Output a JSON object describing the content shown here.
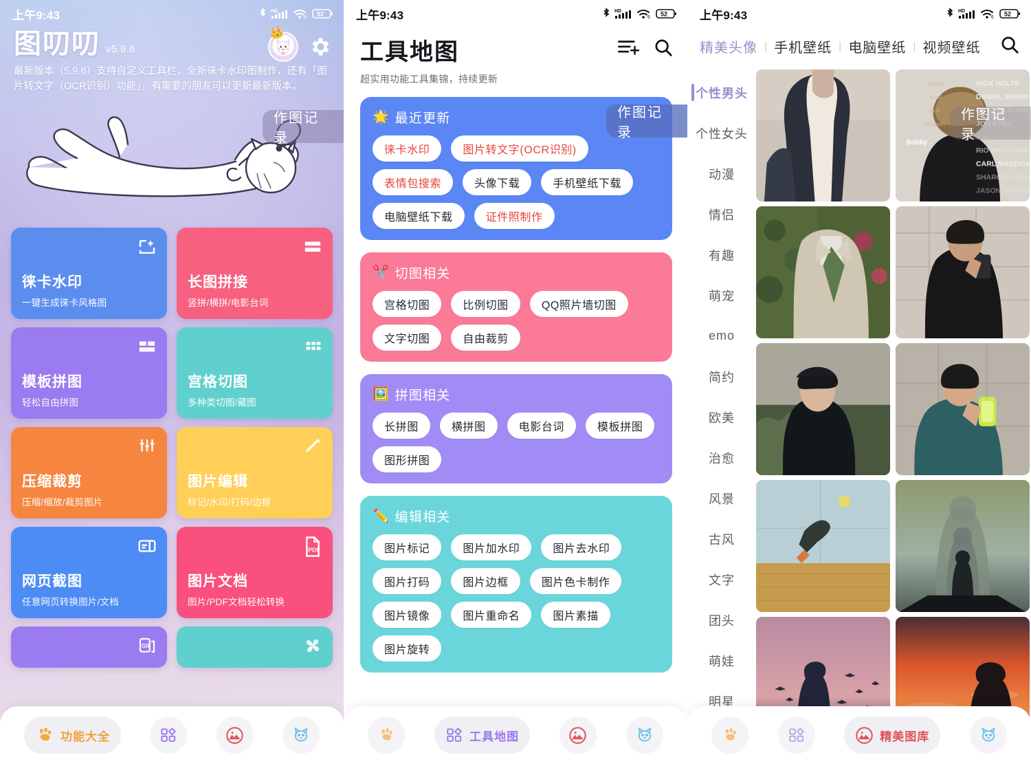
{
  "status_bar": {
    "time": "上午9:43",
    "icons": [
      "bluetooth-icon",
      "hd-icon",
      "signal-icon",
      "wifi6-icon",
      "battery-icon"
    ],
    "battery_level": "52"
  },
  "panel_home": {
    "app_title": "图叨叨",
    "version": "v5.9.6",
    "description": "最新版本（5.9.6）支持自定义工具栏，全新徕卡水印图制作，还有「图片转文字（OCR识别）功能」，有需要的朋友可以更新最新版本。",
    "avatar_icon": "cat-avatar-icon",
    "crown_icon": "crown-icon",
    "settings_icon": "gear-icon",
    "floating_button": "作图记录",
    "illustration": "lying-cat-illustration",
    "tiles": [
      {
        "name": "徕卡水印",
        "sub": "一键生成徕卡风格图",
        "color": "#5b8def",
        "icon": "magic-photo-icon"
      },
      {
        "name": "长图拼接",
        "sub": "竖拼/横拼/电影台词",
        "color": "#f8607f",
        "icon": "stack-rows-icon"
      },
      {
        "name": "模板拼图",
        "sub": "轻松自由拼图",
        "color": "#9b7bf0",
        "icon": "layout-template-icon"
      },
      {
        "name": "宫格切图",
        "sub": "多种类切图/藏图",
        "color": "#5fd0cd",
        "icon": "grid-nine-icon"
      },
      {
        "name": "压缩裁剪",
        "sub": "压缩/缩放/裁剪图片",
        "color": "#f5853f",
        "icon": "sliders-icon"
      },
      {
        "name": "图片编辑",
        "sub": "标记/水印/打码/边框",
        "color": "#ffcf57",
        "icon": "pencil-icon"
      },
      {
        "name": "网页截图",
        "sub": "任意网页转换图片/文档",
        "color": "#4d8cf5",
        "icon": "browser-capture-icon"
      },
      {
        "name": "图片文档",
        "sub": "图片/PDF文档轻松转换",
        "color": "#f9507e",
        "icon": "pdf-file-icon"
      },
      {
        "name": "",
        "sub": "",
        "color": "#9b7bf0",
        "icon": "gif-icon"
      },
      {
        "name": "",
        "sub": "",
        "color": "#5fd0cd",
        "icon": "pinwheel-icon"
      }
    ],
    "bottom_nav": [
      {
        "label": "功能大全",
        "icon": "paw-icon",
        "active": true
      },
      {
        "label": "",
        "icon": "shapes-icon",
        "active": false
      },
      {
        "label": "",
        "icon": "mountain-circle-icon",
        "active": false
      },
      {
        "label": "",
        "icon": "cat-face-icon",
        "active": false
      }
    ]
  },
  "panel_tools": {
    "title": "工具地图",
    "subtitle": "超实用功能工具集锦，持续更新",
    "actions": [
      "add-to-list-icon",
      "search-icon"
    ],
    "floating_button": "作图记录",
    "groups": [
      {
        "name": "最近更新",
        "emoji": "🌟",
        "icon": "sun-badge-icon",
        "color": "#5b87f5",
        "chips": [
          {
            "label": "徕卡水印",
            "hot": true
          },
          {
            "label": "图片转文字(OCR识别)",
            "hot": true
          },
          {
            "label": "表情包搜索",
            "hot": true
          },
          {
            "label": "头像下载",
            "hot": false
          },
          {
            "label": "手机壁纸下载",
            "hot": false
          },
          {
            "label": "电脑壁纸下载",
            "hot": false
          },
          {
            "label": "证件照制作",
            "hot": true
          }
        ]
      },
      {
        "name": "切图相关",
        "emoji": "✂️",
        "icon": "scissors-icon",
        "color": "#fa7a97",
        "chips": [
          {
            "label": "宫格切图",
            "hot": false
          },
          {
            "label": "比例切图",
            "hot": false
          },
          {
            "label": "QQ照片墙切图",
            "hot": false
          },
          {
            "label": "文字切图",
            "hot": false
          },
          {
            "label": "自由裁剪",
            "hot": false
          }
        ]
      },
      {
        "name": "拼图相关",
        "emoji": "🖼️",
        "icon": "board-icon",
        "color": "#a18cf5",
        "chips": [
          {
            "label": "长拼图",
            "hot": false
          },
          {
            "label": "横拼图",
            "hot": false
          },
          {
            "label": "电影台词",
            "hot": false
          },
          {
            "label": "模板拼图",
            "hot": false
          },
          {
            "label": "图形拼图",
            "hot": false
          }
        ]
      },
      {
        "name": "编辑相关",
        "emoji": "✏️",
        "icon": "pencil-icon",
        "color": "#6ad6dc",
        "chips": [
          {
            "label": "图片标记",
            "hot": false
          },
          {
            "label": "图片加水印",
            "hot": false
          },
          {
            "label": "图片去水印",
            "hot": false
          },
          {
            "label": "图片打码",
            "hot": false
          },
          {
            "label": "图片边框",
            "hot": false
          },
          {
            "label": "图片色卡制作",
            "hot": false
          },
          {
            "label": "图片镜像",
            "hot": false
          },
          {
            "label": "图片重命名",
            "hot": false
          },
          {
            "label": "图片素描",
            "hot": false
          },
          {
            "label": "图片旋转",
            "hot": false
          }
        ]
      }
    ],
    "bottom_nav": [
      {
        "label": "",
        "icon": "paw-icon",
        "active": false
      },
      {
        "label": "工具地图",
        "icon": "shapes-icon",
        "active": true
      },
      {
        "label": "",
        "icon": "mountain-circle-icon",
        "active": false
      },
      {
        "label": "",
        "icon": "cat-face-icon",
        "active": false
      }
    ]
  },
  "panel_gallery": {
    "tabs": [
      {
        "label": "精美头像",
        "active": true
      },
      {
        "label": "手机壁纸",
        "active": false
      },
      {
        "label": "电脑壁纸",
        "active": false
      },
      {
        "label": "视频壁纸",
        "active": false
      }
    ],
    "search_icon": "search-icon",
    "floating_button": "作图记录",
    "categories": [
      {
        "label": "个性男头",
        "active": true
      },
      {
        "label": "个性女头",
        "active": false
      },
      {
        "label": "动漫",
        "active": false
      },
      {
        "label": "情侣",
        "active": false
      },
      {
        "label": "有趣",
        "active": false
      },
      {
        "label": "萌宠",
        "active": false
      },
      {
        "label": "emo",
        "active": false
      },
      {
        "label": "简约",
        "active": false
      },
      {
        "label": "欧美",
        "active": false
      },
      {
        "label": "治愈",
        "active": false
      },
      {
        "label": "风景",
        "active": false
      },
      {
        "label": "古风",
        "active": false
      },
      {
        "label": "文字",
        "active": false
      },
      {
        "label": "团头",
        "active": false
      },
      {
        "label": "萌娃",
        "active": false
      },
      {
        "label": "明星",
        "active": false
      }
    ],
    "photos": [
      {
        "name": "man-white-tank-top",
        "kind": "portrait-tank"
      },
      {
        "name": "man-back-credits-text",
        "kind": "credits"
      },
      {
        "name": "man-suit-green-tie-garden",
        "kind": "suit-garden"
      },
      {
        "name": "man-black-suit-mirror-selfie",
        "kind": "mirror-dark"
      },
      {
        "name": "man-beret-black-coat-outdoors",
        "kind": "beret"
      },
      {
        "name": "man-teal-sweater-phone-selfie",
        "kind": "teal-selfie"
      },
      {
        "name": "floating-person-field-moon",
        "kind": "field-moon"
      },
      {
        "name": "layered-silhouettes-fog",
        "kind": "fog-silhouette"
      },
      {
        "name": "silhouette-birds-dusk",
        "kind": "birds-dusk"
      },
      {
        "name": "silhouette-orange-sunset",
        "kind": "orange-sunset"
      }
    ],
    "bottom_nav": [
      {
        "label": "",
        "icon": "paw-icon",
        "active": false
      },
      {
        "label": "",
        "icon": "shapes-icon",
        "active": false
      },
      {
        "label": "精美图库",
        "icon": "mountain-circle-icon",
        "active": true
      },
      {
        "label": "",
        "icon": "cat-face-icon",
        "active": false
      }
    ]
  }
}
